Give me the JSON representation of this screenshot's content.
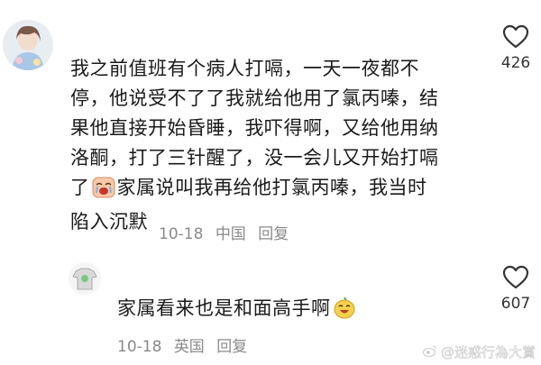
{
  "comments": [
    {
      "text_lines": [
        "我之前值班有个病人打嗝，一天一夜都不",
        "停，他说受不了了我就给他用了氯丙嗪，结",
        "果他直接开始昏睡，我吓得啊，又给他用纳",
        "洛酮，打了三针醒了，没一会儿又开始打嗝"
      ],
      "text_line5_before": "了",
      "text_line5_after": "家属说叫我再给他打氯丙嗪，我当时",
      "text_line6": "陷入沉默",
      "emoji": "crying-face-icon",
      "date": "10-18",
      "location": "中国",
      "reply_label": "回复",
      "likes": "426"
    },
    {
      "text": "家属看来也是和面高手啊",
      "emoji": "laughing-face-icon",
      "date": "10-18",
      "location": "英国",
      "reply_label": "回复",
      "likes": "607"
    }
  ],
  "watermark": "@迷惑行為大賞"
}
